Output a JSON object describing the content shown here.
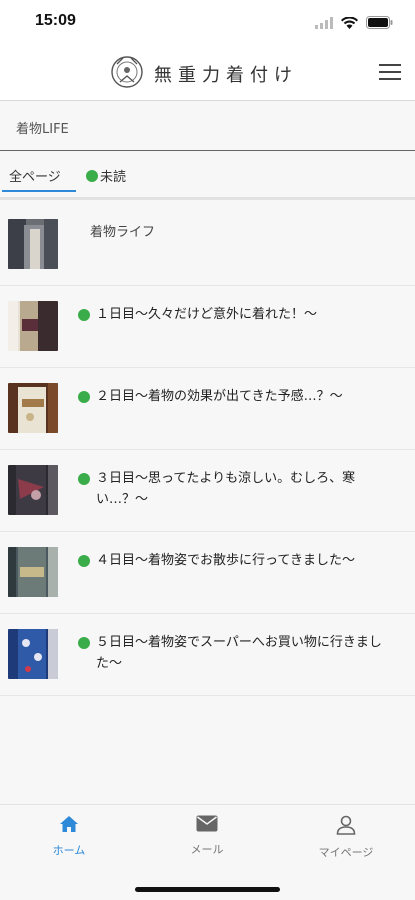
{
  "status_bar": {
    "time": "15:09"
  },
  "header": {
    "logo_text": "無重力着付け"
  },
  "section": {
    "title": "着物LIFE"
  },
  "tabs": [
    {
      "label": "全ページ",
      "active": true
    },
    {
      "label": "未読",
      "active": false
    }
  ],
  "articles": [
    {
      "title": "着物ライフ",
      "unread": false,
      "thumb_icon": "kimono-photo-icon"
    },
    {
      "title": "１日目〜久々だけど意外に着れた！〜",
      "unread": true,
      "thumb_icon": "kimono-photo-icon"
    },
    {
      "title": "２日目〜着物の効果が出てきた予感…？〜",
      "unread": true,
      "thumb_icon": "kimono-photo-icon"
    },
    {
      "title": "３日目〜思ってたよりも涼しい。むしろ、寒い…？〜",
      "unread": true,
      "thumb_icon": "kimono-photo-icon"
    },
    {
      "title": "４日目〜着物姿でお散歩に行ってきました〜",
      "unread": true,
      "thumb_icon": "kimono-photo-icon"
    },
    {
      "title": "５日目〜着物姿でスーパーへお買い物に行きました〜",
      "unread": true,
      "thumb_icon": "kimono-photo-icon"
    }
  ],
  "bottom_nav": [
    {
      "label": "ホーム",
      "icon": "home-icon",
      "active": true
    },
    {
      "label": "メール",
      "icon": "mail-icon",
      "active": false
    },
    {
      "label": "マイページ",
      "icon": "person-icon",
      "active": false
    }
  ],
  "colors": {
    "accent": "#2e8ad8",
    "unread_dot": "#3aac49"
  }
}
